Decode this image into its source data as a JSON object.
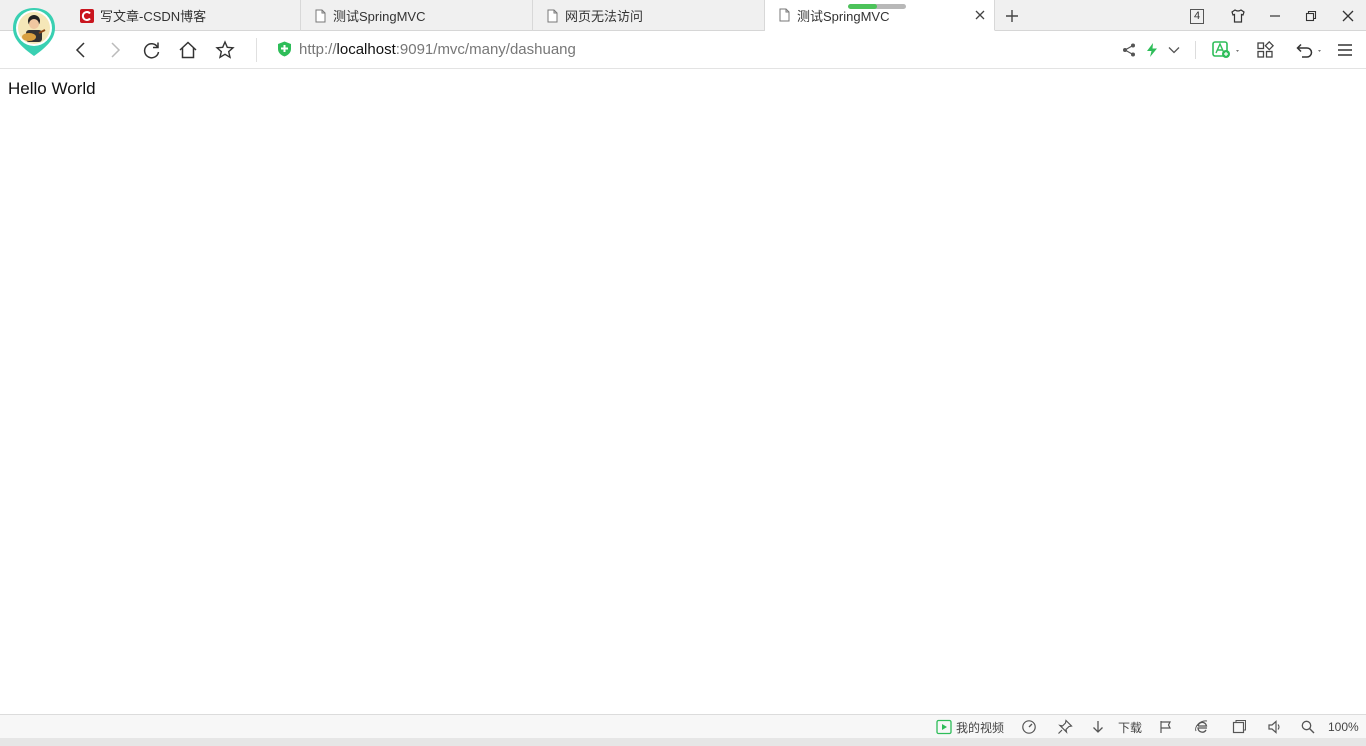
{
  "tabs": [
    {
      "title": "写文章-CSDN博客",
      "favicon": "csdn-logo-icon",
      "active": false
    },
    {
      "title": "测试SpringMVC",
      "favicon": "page-icon",
      "active": false
    },
    {
      "title": "网页无法访问",
      "favicon": "page-icon",
      "active": false
    },
    {
      "title": "测试SpringMVC",
      "favicon": "page-icon",
      "active": true
    }
  ],
  "tab_count": "4",
  "page_loading_progress": 0.5,
  "address_bar": {
    "scheme": "http://",
    "host": "localhost",
    "rest": ":9091/mvc/many/dashuang"
  },
  "page": {
    "text": "Hello World"
  },
  "status_bar": {
    "my_video": "我的视频",
    "download": "下载",
    "zoom": "100%"
  },
  "colors": {
    "accent_green": "#4cc35a",
    "csdn_red": "#c9151e",
    "secure_green": "#2ebd59"
  }
}
